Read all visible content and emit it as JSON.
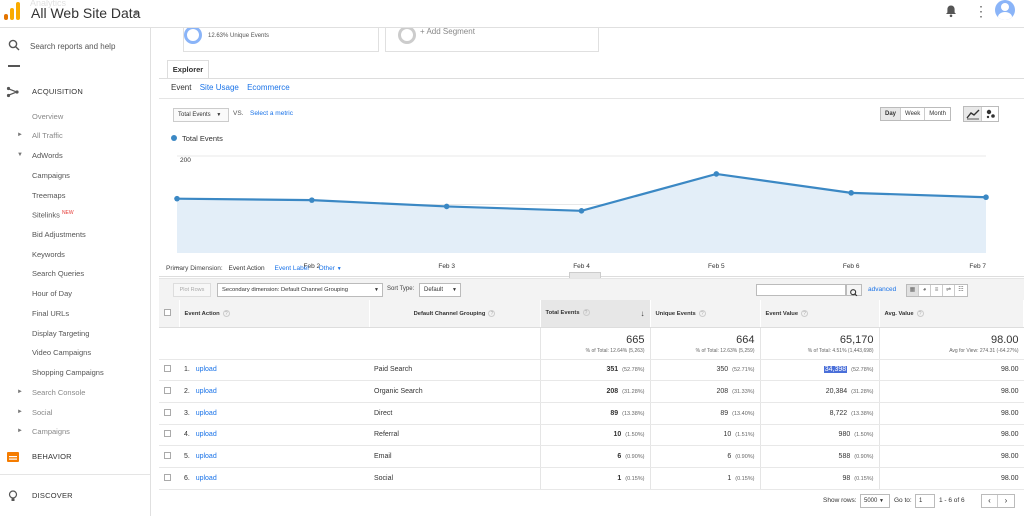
{
  "header": {
    "crumb": "Analytics",
    "title": "All Web Site Data"
  },
  "sidebar": {
    "search_placeholder": "Search reports and help",
    "acquisition": "ACQUISITION",
    "items": [
      {
        "label": "Overview"
      },
      {
        "label": "All Traffic"
      },
      {
        "label": "AdWords"
      },
      {
        "label": "Campaigns"
      },
      {
        "label": "Treemaps"
      },
      {
        "label": "Sitelinks",
        "badge": "NEW"
      },
      {
        "label": "Bid Adjustments"
      },
      {
        "label": "Keywords"
      },
      {
        "label": "Search Queries"
      },
      {
        "label": "Hour of Day"
      },
      {
        "label": "Final URLs"
      },
      {
        "label": "Display Targeting"
      },
      {
        "label": "Video Campaigns"
      },
      {
        "label": "Shopping Campaigns"
      },
      {
        "label": "Search Console"
      },
      {
        "label": "Social"
      },
      {
        "label": "Campaigns"
      }
    ],
    "behavior": "BEHAVIOR",
    "discover": "DISCOVER"
  },
  "segments": {
    "seg1_name": "All Users",
    "seg1_sub": "12.63% Unique Events",
    "add_segment": "+ Add Segment"
  },
  "explorer": {
    "tab": "Explorer",
    "subtabs": [
      "Event",
      "Site Usage",
      "Ecommerce"
    ],
    "metric_select": "Total Events",
    "vs": "VS.",
    "select_metric": "Select a metric",
    "periods": [
      "Day",
      "Week",
      "Month"
    ],
    "legend": "Total Events"
  },
  "chart_data": {
    "type": "line",
    "series": [
      {
        "name": "Total Events",
        "values": [
          112,
          109,
          96,
          87,
          163,
          124,
          115
        ]
      }
    ],
    "x_labels": [
      "...",
      "Feb 2",
      "Feb 3",
      "Feb 4",
      "Feb 5",
      "Feb 6",
      "Feb 7"
    ],
    "y_ticks": [
      "200",
      "100"
    ],
    "ylim": [
      0,
      200
    ],
    "color": "#3b88c4",
    "fill": "#e3eef8"
  },
  "primary_dimension": {
    "label": "Primary Dimension:",
    "options": [
      "Event Action",
      "Event Label",
      "Other"
    ]
  },
  "table_controls": {
    "plot_rows": "Plot Rows",
    "secondary_dimension": "Secondary dimension: Default Channel Grouping",
    "sort_type_label": "Sort Type:",
    "sort_type": "Default",
    "advanced": "advanced"
  },
  "table": {
    "headers": [
      "Event Action",
      "Default Channel Grouping",
      "Total Events",
      "Unique Events",
      "Event Value",
      "Avg. Value"
    ],
    "summary": {
      "total_events": "665",
      "total_events_of": "% of Total: 12.64% (5,263)",
      "unique_events": "664",
      "unique_events_of": "% of Total: 12.63% (5,259)",
      "event_value": "65,170",
      "event_value_of": "% of Total: 4.51% (1,443,698)",
      "avg_value": "98.00",
      "avg_value_of": "Avg for View: 274.31 (-64.27%)"
    },
    "rows": [
      {
        "n": "1.",
        "action": "upload",
        "channel": "Paid Search",
        "te": "351",
        "te_pct": "(52.78%)",
        "ue": "350",
        "ue_pct": "(52.71%)",
        "ev": "34,398",
        "ev_pct": "(52.78%)",
        "avg": "98.00"
      },
      {
        "n": "2.",
        "action": "upload",
        "channel": "Organic Search",
        "te": "208",
        "te_pct": "(31.28%)",
        "ue": "208",
        "ue_pct": "(31.33%)",
        "ev": "20,384",
        "ev_pct": "(31.28%)",
        "avg": "98.00"
      },
      {
        "n": "3.",
        "action": "upload",
        "channel": "Direct",
        "te": "89",
        "te_pct": "(13.38%)",
        "ue": "89",
        "ue_pct": "(13.40%)",
        "ev": "8,722",
        "ev_pct": "(13.38%)",
        "avg": "98.00"
      },
      {
        "n": "4.",
        "action": "upload",
        "channel": "Referral",
        "te": "10",
        "te_pct": "(1.50%)",
        "ue": "10",
        "ue_pct": "(1.51%)",
        "ev": "980",
        "ev_pct": "(1.50%)",
        "avg": "98.00"
      },
      {
        "n": "5.",
        "action": "upload",
        "channel": "Email",
        "te": "6",
        "te_pct": "(0.90%)",
        "ue": "6",
        "ue_pct": "(0.90%)",
        "ev": "588",
        "ev_pct": "(0.90%)",
        "avg": "98.00"
      },
      {
        "n": "6.",
        "action": "upload",
        "channel": "Social",
        "te": "1",
        "te_pct": "(0.15%)",
        "ue": "1",
        "ue_pct": "(0.15%)",
        "ev": "98",
        "ev_pct": "(0.15%)",
        "avg": "98.00"
      }
    ]
  },
  "pager": {
    "show_rows_label": "Show rows:",
    "show_rows": "5000",
    "goto_label": "Go to:",
    "goto": "1",
    "range": "1 - 6 of 6"
  }
}
